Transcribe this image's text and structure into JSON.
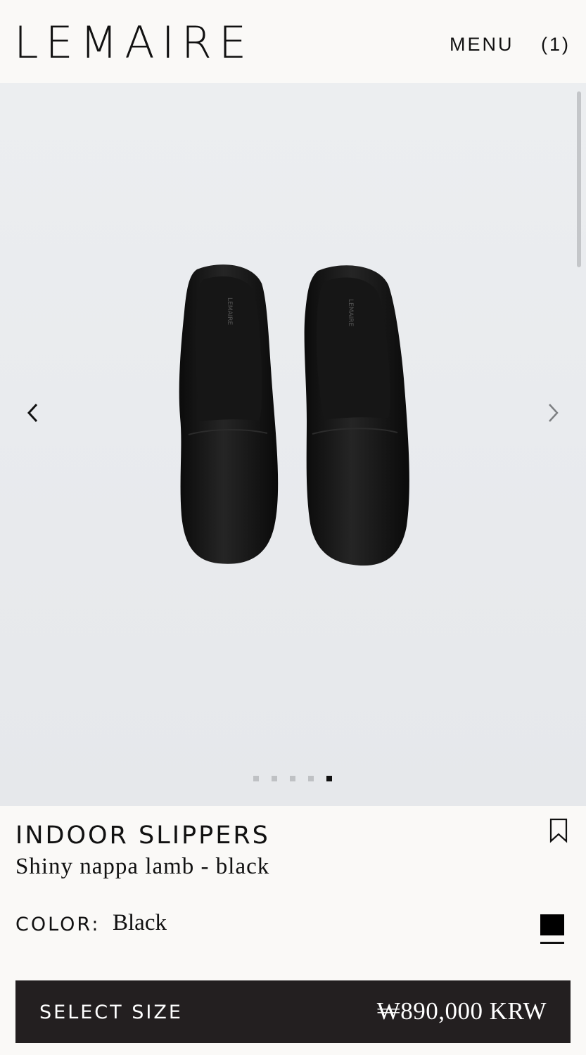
{
  "header": {
    "logo": "LEMAIRE",
    "menu_label": "MENU",
    "cart_label": "(1)"
  },
  "gallery": {
    "prev_icon": "chevron-left-icon",
    "next_icon": "chevron-right-icon",
    "image_count": 5,
    "active_index": 4
  },
  "product": {
    "title": "INDOOR SLIPPERS",
    "subtitle": "Shiny nappa lamb - black",
    "bookmark_icon": "bookmark-icon",
    "color_label": "COLOR:",
    "color_value": "Black",
    "swatch_color": "#000000"
  },
  "cta": {
    "label": "SELECT SIZE",
    "price": "₩890,000 KRW",
    "background": "#231f20"
  }
}
